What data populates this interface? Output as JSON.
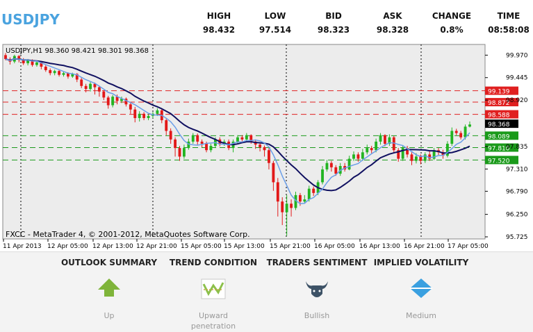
{
  "header": {
    "symbol": "USDJPY",
    "stats": [
      {
        "label": "HIGH",
        "value": "98.432"
      },
      {
        "label": "LOW",
        "value": "97.514"
      },
      {
        "label": "BID",
        "value": "98.323"
      },
      {
        "label": "ASK",
        "value": "98.328"
      },
      {
        "label": "CHANGE",
        "value": "0.8%"
      },
      {
        "label": "TIME",
        "value": "08:58:08"
      }
    ]
  },
  "chart_data": {
    "type": "candlestick",
    "title": "USDJPY,H1  98.360 98.421 98.301 98.368",
    "footer": "FXCC - MetaTrader 4, © 2001-2012, MetaQuotes Software Corp.",
    "y_ticks": [
      "99.970",
      "99.445",
      "98.920",
      "98.368",
      "97.835",
      "97.310",
      "96.790",
      "96.250",
      "95.725"
    ],
    "y_tick_values": [
      99.97,
      99.445,
      98.92,
      98.368,
      97.835,
      97.31,
      96.79,
      96.25,
      95.725
    ],
    "ylim": [
      95.725,
      100.09
    ],
    "x_ticks": [
      "11 Apr 2013",
      "12 Apr 05:00",
      "12 Apr 13:00",
      "12 Apr 21:00",
      "15 Apr 05:00",
      "15 Apr 13:00",
      "15 Apr 21:00",
      "16 Apr 05:00",
      "16 Apr 13:00",
      "16 Apr 21:00",
      "17 Apr 05:00"
    ],
    "levels": [
      {
        "value": 99.139,
        "label": "99.139",
        "color": "#e02020"
      },
      {
        "value": 98.872,
        "label": "98.872",
        "color": "#e02020"
      },
      {
        "value": 98.588,
        "label": "98.588",
        "color": "#e02020"
      },
      {
        "value": 98.089,
        "label": "98.089",
        "color": "#1a9a1a"
      },
      {
        "value": 97.81,
        "label": "97.810",
        "color": "#1a9a1a"
      },
      {
        "value": 97.52,
        "label": "97.520",
        "color": "#1a9a1a"
      }
    ],
    "current_price": {
      "value": 98.368,
      "label": "98.368"
    },
    "grid": true,
    "colors": {
      "up": "#22b422",
      "down": "#e21818",
      "ma_slow": "#101060",
      "ma_fast": "#6a9ee8"
    },
    "candles": [
      [
        99.97,
        99.88,
        100.02,
        99.85
      ],
      [
        99.88,
        99.82,
        99.92,
        99.75
      ],
      [
        99.82,
        99.95,
        99.98,
        99.78
      ],
      [
        99.95,
        99.86,
        99.97,
        99.8
      ],
      [
        99.86,
        99.78,
        99.9,
        99.74
      ],
      [
        99.78,
        99.85,
        99.88,
        99.73
      ],
      [
        99.85,
        99.74,
        99.87,
        99.7
      ],
      [
        99.74,
        99.8,
        99.82,
        99.7
      ],
      [
        99.8,
        99.7,
        99.83,
        99.64
      ],
      [
        99.7,
        99.62,
        99.74,
        99.58
      ],
      [
        99.62,
        99.55,
        99.66,
        99.5
      ],
      [
        99.55,
        99.6,
        99.63,
        99.5
      ],
      [
        99.6,
        99.51,
        99.62,
        99.47
      ],
      [
        99.51,
        99.55,
        99.58,
        99.47
      ],
      [
        99.55,
        99.47,
        99.57,
        99.42
      ],
      [
        99.47,
        99.53,
        99.56,
        99.44
      ],
      [
        99.53,
        99.4,
        99.55,
        99.34
      ],
      [
        99.4,
        99.25,
        99.44,
        99.2
      ],
      [
        99.25,
        99.18,
        99.3,
        99.1
      ],
      [
        99.18,
        99.3,
        99.34,
        99.12
      ],
      [
        99.3,
        99.22,
        99.33,
        99.05
      ],
      [
        99.22,
        99.12,
        99.26,
        99.0
      ],
      [
        99.12,
        98.98,
        99.15,
        98.92
      ],
      [
        98.98,
        98.8,
        99.02,
        98.72
      ],
      [
        98.8,
        99.0,
        99.04,
        98.75
      ],
      [
        99.0,
        98.9,
        99.05,
        98.82
      ],
      [
        98.9,
        98.95,
        99.0,
        98.85
      ],
      [
        98.95,
        98.82,
        98.98,
        98.77
      ],
      [
        98.82,
        98.7,
        98.87,
        98.6
      ],
      [
        98.7,
        98.5,
        98.76,
        98.4
      ],
      [
        98.5,
        98.6,
        98.66,
        98.42
      ],
      [
        98.6,
        98.5,
        98.64,
        98.45
      ],
      [
        98.5,
        98.55,
        98.6,
        98.45
      ],
      [
        98.55,
        98.6,
        98.64,
        98.5
      ],
      [
        98.6,
        98.68,
        98.73,
        98.55
      ],
      [
        98.68,
        98.45,
        98.72,
        98.38
      ],
      [
        98.45,
        98.2,
        98.5,
        98.1
      ],
      [
        98.2,
        98.0,
        98.26,
        97.9
      ],
      [
        98.0,
        97.8,
        98.05,
        97.6
      ],
      [
        97.8,
        97.6,
        97.85,
        97.5
      ],
      [
        97.6,
        97.8,
        97.88,
        97.55
      ],
      [
        97.8,
        97.95,
        98.02,
        97.76
      ],
      [
        97.95,
        98.1,
        98.15,
        97.9
      ],
      [
        98.1,
        97.95,
        98.14,
        97.88
      ],
      [
        97.95,
        97.9,
        98.0,
        97.82
      ],
      [
        97.9,
        97.75,
        97.95,
        97.7
      ],
      [
        97.75,
        97.85,
        97.9,
        97.7
      ],
      [
        97.85,
        98.0,
        98.05,
        97.8
      ],
      [
        98.0,
        97.9,
        98.05,
        97.84
      ],
      [
        97.9,
        97.95,
        98.0,
        97.85
      ],
      [
        97.95,
        97.8,
        98.0,
        97.75
      ],
      [
        97.8,
        97.95,
        98.0,
        97.7
      ],
      [
        97.95,
        98.05,
        98.1,
        97.9
      ],
      [
        98.05,
        98.0,
        98.1,
        97.92
      ],
      [
        98.0,
        98.1,
        98.15,
        97.95
      ],
      [
        98.1,
        97.95,
        98.12,
        97.9
      ],
      [
        97.95,
        97.88,
        98.0,
        97.78
      ],
      [
        97.88,
        97.82,
        97.92,
        97.72
      ],
      [
        97.82,
        97.75,
        97.86,
        97.6
      ],
      [
        97.75,
        97.45,
        97.8,
        97.3
      ],
      [
        97.45,
        97.0,
        97.5,
        96.8
      ],
      [
        97.0,
        96.55,
        97.1,
        96.2
      ],
      [
        96.55,
        96.3,
        96.65,
        96.0
      ],
      [
        96.3,
        96.5,
        96.7,
        95.75
      ],
      [
        96.5,
        96.4,
        96.6,
        96.2
      ],
      [
        96.4,
        96.7,
        96.78,
        96.35
      ],
      [
        96.7,
        96.55,
        96.75,
        96.45
      ],
      [
        96.55,
        96.6,
        96.7,
        96.5
      ],
      [
        96.6,
        96.85,
        96.92,
        96.55
      ],
      [
        96.85,
        96.75,
        96.9,
        96.68
      ],
      [
        96.75,
        97.0,
        97.05,
        96.7
      ],
      [
        97.0,
        97.3,
        97.38,
        96.95
      ],
      [
        97.3,
        97.45,
        97.52,
        97.25
      ],
      [
        97.45,
        97.35,
        97.5,
        97.25
      ],
      [
        97.35,
        97.2,
        97.4,
        97.15
      ],
      [
        97.2,
        97.38,
        97.45,
        97.15
      ],
      [
        97.38,
        97.3,
        97.45,
        97.25
      ],
      [
        97.3,
        97.55,
        97.62,
        97.28
      ],
      [
        97.55,
        97.65,
        97.72,
        97.5
      ],
      [
        97.65,
        97.55,
        97.7,
        97.48
      ],
      [
        97.55,
        97.7,
        97.78,
        97.5
      ],
      [
        97.7,
        97.8,
        97.88,
        97.65
      ],
      [
        97.8,
        97.75,
        97.85,
        97.68
      ],
      [
        97.75,
        97.95,
        98.02,
        97.7
      ],
      [
        97.95,
        98.1,
        98.15,
        97.88
      ],
      [
        98.1,
        97.9,
        98.12,
        97.84
      ],
      [
        97.9,
        98.05,
        98.12,
        97.85
      ],
      [
        98.05,
        97.75,
        98.08,
        97.68
      ],
      [
        97.75,
        97.55,
        97.8,
        97.48
      ],
      [
        97.55,
        97.8,
        97.85,
        97.5
      ],
      [
        97.8,
        97.65,
        97.85,
        97.58
      ],
      [
        97.65,
        97.5,
        97.7,
        97.4
      ],
      [
        97.5,
        97.6,
        97.68,
        97.44
      ],
      [
        97.6,
        97.5,
        97.65,
        97.42
      ],
      [
        97.5,
        97.65,
        97.7,
        97.45
      ],
      [
        97.65,
        97.55,
        97.72,
        97.5
      ],
      [
        97.55,
        97.75,
        97.8,
        97.52
      ],
      [
        97.75,
        97.7,
        97.8,
        97.64
      ],
      [
        97.7,
        97.62,
        97.76,
        97.55
      ],
      [
        97.62,
        97.9,
        97.96,
        97.58
      ],
      [
        97.9,
        98.2,
        98.28,
        97.85
      ],
      [
        98.2,
        98.15,
        98.25,
        98.1
      ],
      [
        98.15,
        98.05,
        98.2,
        98.0
      ],
      [
        98.05,
        98.3,
        98.35,
        98.0
      ],
      [
        98.3,
        98.35,
        98.42,
        98.28
      ]
    ]
  },
  "summary": [
    {
      "title": "OUTLOOK SUMMARY",
      "value": "Up",
      "icon": "up-arrow-icon"
    },
    {
      "title": "TREND CONDITION",
      "value": "Upward penetration",
      "icon": "trend-chart-icon"
    },
    {
      "title": "TRADERS SENTIMENT",
      "value": "Bullish",
      "icon": "bull-icon"
    },
    {
      "title": "IMPLIED VOLATILITY",
      "value": "Medium",
      "icon": "volatility-diamond-icon"
    }
  ]
}
